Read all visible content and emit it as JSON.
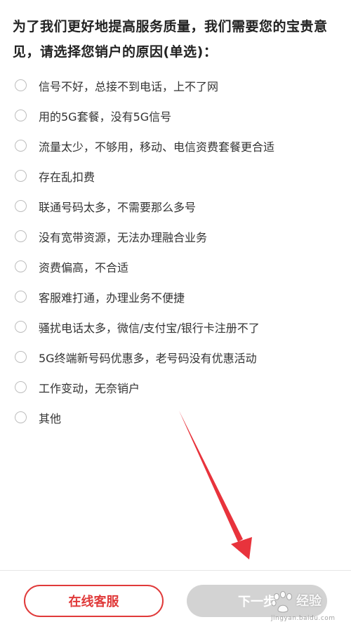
{
  "question": {
    "text": "为了我们更好地提高服务质量，我们需要您的宝贵意见，请选择您销户的原因(单选)："
  },
  "options": [
    {
      "label": "信号不好，总接不到电话，上不了网"
    },
    {
      "label": "用的5G套餐，没有5G信号"
    },
    {
      "label": "流量太少，不够用，移动、电信资费套餐更合适"
    },
    {
      "label": "存在乱扣费"
    },
    {
      "label": "联通号码太多，不需要那么多号"
    },
    {
      "label": "没有宽带资源，无法办理融合业务"
    },
    {
      "label": "资费偏高，不合适"
    },
    {
      "label": "客服难打通，办理业务不便捷"
    },
    {
      "label": "骚扰电话太多，微信/支付宝/银行卡注册不了"
    },
    {
      "label": "5G终端新号码优惠多，老号码没有优惠活动"
    },
    {
      "label": "工作变动，无奈销户"
    },
    {
      "label": "其他"
    }
  ],
  "footer": {
    "service_label": "在线客服",
    "next_label": "下一步"
  },
  "watermark": {
    "text": "经验",
    "url": "jingyan.baidu.com"
  },
  "colors": {
    "accent": "#e03a3a",
    "disabled_button": "#d3d3d3",
    "radio_border": "#bdbdbd",
    "annotation_arrow": "#e8333c"
  }
}
